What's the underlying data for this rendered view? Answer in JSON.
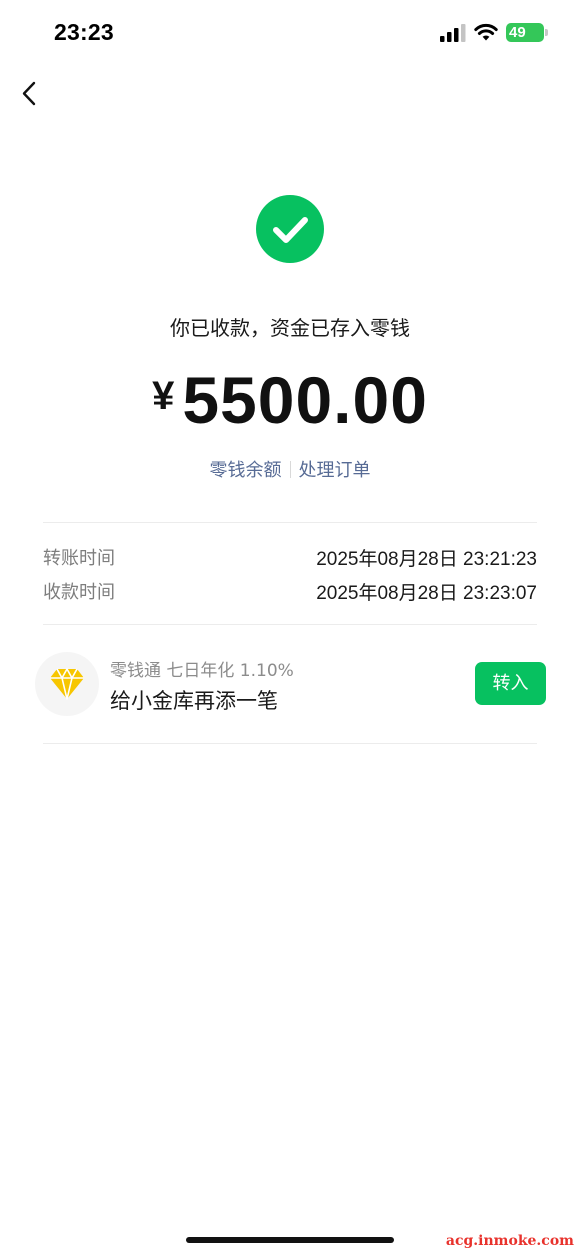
{
  "status_bar": {
    "time": "23:23",
    "battery": "49",
    "battery_color": "#34c759"
  },
  "header": {
    "back_icon": "chevron-left-icon"
  },
  "result": {
    "icon": "check-circle-icon",
    "accent_color": "#07c160",
    "title": "你已收款，资金已存入零钱",
    "currency": "¥",
    "amount": "5500.00"
  },
  "links": {
    "balance": "零钱余额",
    "handle_order": "处理订单",
    "color": "#576b95"
  },
  "details": [
    {
      "label": "转账时间",
      "value": "2025年08月28日 23:21:23"
    },
    {
      "label": "收款时间",
      "value": "2025年08月28日 23:23:07"
    }
  ],
  "promo": {
    "icon": "diamond-icon",
    "subtitle": "零钱通 七日年化 1.10%",
    "title": "给小金库再添一笔",
    "button": "转入"
  },
  "watermark": "acg.inmoke.com"
}
